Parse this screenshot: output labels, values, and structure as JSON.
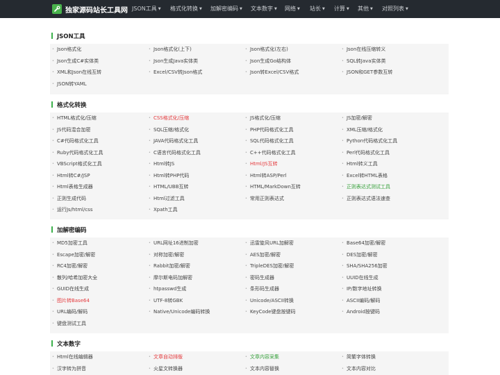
{
  "nav": {
    "brand": "独家源码站长工具网",
    "menu": [
      "JSON工具",
      "格式化转换",
      "加解密编码",
      "文本数字",
      "网络",
      "站长",
      "计算",
      "其他",
      "对照列表"
    ]
  },
  "sections": [
    {
      "title": "JSON工具",
      "items": [
        {
          "label": "Json格式化",
          "style": "normal"
        },
        {
          "label": "Json格式化(上下)",
          "style": "normal"
        },
        {
          "label": "Json格式化(左右)",
          "style": "normal"
        },
        {
          "label": "Json在线压缩转义",
          "style": "normal"
        },
        {
          "label": "Json生成C#实体类",
          "style": "normal"
        },
        {
          "label": "Json生成Java实体类",
          "style": "normal"
        },
        {
          "label": "Json生成Go结构体",
          "style": "normal"
        },
        {
          "label": "SQL转Java实体类",
          "style": "normal"
        },
        {
          "label": "XML和Json在线互转",
          "style": "normal"
        },
        {
          "label": "Excel/CSV转Json格式",
          "style": "normal"
        },
        {
          "label": "Json转Excel/CSV格式",
          "style": "normal"
        },
        {
          "label": "JSON和GET参数互转",
          "style": "normal"
        },
        {
          "label": "JSON转YAML",
          "style": "normal"
        }
      ]
    },
    {
      "title": "格式化转换",
      "items": [
        {
          "label": "HTML格式化/压缩",
          "style": "normal"
        },
        {
          "label": "CSS格式化/压缩",
          "style": "red"
        },
        {
          "label": "JS格式化/压缩",
          "style": "normal"
        },
        {
          "label": "JS加密/解密",
          "style": "normal"
        },
        {
          "label": "JS代码混合加密",
          "style": "normal"
        },
        {
          "label": "SQL压缩/格式化",
          "style": "normal"
        },
        {
          "label": "PHP代码格式化工具",
          "style": "normal"
        },
        {
          "label": "XML压缩/格式化",
          "style": "normal"
        },
        {
          "label": "C#代码格式化工具",
          "style": "normal"
        },
        {
          "label": "JAVA代码格式化工具",
          "style": "normal"
        },
        {
          "label": "SQL代码格式化工具",
          "style": "normal"
        },
        {
          "label": "Python代码格式化工具",
          "style": "normal"
        },
        {
          "label": "Ruby代码格式化工具",
          "style": "normal"
        },
        {
          "label": "C语言代码格式化工具",
          "style": "normal"
        },
        {
          "label": "C++代码格式化工具",
          "style": "normal"
        },
        {
          "label": "Perl代码格式化工具",
          "style": "normal"
        },
        {
          "label": "VBScript格式化工具",
          "style": "normal"
        },
        {
          "label": "Html转JS",
          "style": "normal"
        },
        {
          "label": "Html/JS互转",
          "style": "red"
        },
        {
          "label": "Html转义工具",
          "style": "normal"
        },
        {
          "label": "Html转C#/JSP",
          "style": "normal"
        },
        {
          "label": "Html转PHP代码",
          "style": "normal"
        },
        {
          "label": "Html转ASP/Perl",
          "style": "normal"
        },
        {
          "label": "Excel转HTML表格",
          "style": "normal"
        },
        {
          "label": "Html表格生成器",
          "style": "normal"
        },
        {
          "label": "HTML/UBB互转",
          "style": "normal"
        },
        {
          "label": "HTML/MarkDown互转",
          "style": "normal"
        },
        {
          "label": "正则表达式测试工具",
          "style": "green"
        },
        {
          "label": "正则生成代码",
          "style": "normal"
        },
        {
          "label": "Html过滤工具",
          "style": "normal"
        },
        {
          "label": "常用正则表达式",
          "style": "normal"
        },
        {
          "label": "正则表达式语法速查",
          "style": "normal"
        },
        {
          "label": "运行Js/html/css",
          "style": "normal"
        },
        {
          "label": "Xpath工具",
          "style": "normal"
        }
      ]
    },
    {
      "title": "加解密编码",
      "items": [
        {
          "label": "MD5加密工具",
          "style": "normal"
        },
        {
          "label": "URL网址16进制加密",
          "style": "normal"
        },
        {
          "label": "迅雷旋风URL加解密",
          "style": "normal"
        },
        {
          "label": "Base64加密/解密",
          "style": "normal"
        },
        {
          "label": "Escape加密/解密",
          "style": "normal"
        },
        {
          "label": "对称加密/解密",
          "style": "normal"
        },
        {
          "label": "AES加密/解密",
          "style": "normal"
        },
        {
          "label": "DES加密/解密",
          "style": "normal"
        },
        {
          "label": "RC4加密/解密",
          "style": "normal"
        },
        {
          "label": "Rabbit加密/解密",
          "style": "normal"
        },
        {
          "label": "TripleDES加密/解密",
          "style": "normal"
        },
        {
          "label": "SHA/SHA256加密",
          "style": "normal"
        },
        {
          "label": "散列/哈希加密大全",
          "style": "normal"
        },
        {
          "label": "摩尔斯电码加解密",
          "style": "normal"
        },
        {
          "label": "密码生成器",
          "style": "normal"
        },
        {
          "label": "UUID在线生成",
          "style": "normal"
        },
        {
          "label": "GUID在线生成",
          "style": "normal"
        },
        {
          "label": "htpasswd生成",
          "style": "normal"
        },
        {
          "label": "条形码生成器",
          "style": "normal"
        },
        {
          "label": "IP/数字地址转换",
          "style": "normal"
        },
        {
          "label": "图片转Base64",
          "style": "red"
        },
        {
          "label": "UTF-8转GBK",
          "style": "normal"
        },
        {
          "label": "Unicode/ASCII转换",
          "style": "normal"
        },
        {
          "label": "ASCII编码/解码",
          "style": "normal"
        },
        {
          "label": "URL编码/解码",
          "style": "normal"
        },
        {
          "label": "Native/Unicode编码转换",
          "style": "normal"
        },
        {
          "label": "KeyCode键盘按键码",
          "style": "normal"
        },
        {
          "label": "Android按键码",
          "style": "normal"
        },
        {
          "label": "键盘测试工具",
          "style": "normal"
        }
      ]
    },
    {
      "title": "文本数字",
      "items": [
        {
          "label": "Html在线编辑器",
          "style": "normal"
        },
        {
          "label": "文章自动排版",
          "style": "red"
        },
        {
          "label": "文章内容采集",
          "style": "green"
        },
        {
          "label": "简繁字体转换",
          "style": "normal"
        },
        {
          "label": "汉字转为拼音",
          "style": "normal"
        },
        {
          "label": "火星文转换器",
          "style": "normal"
        },
        {
          "label": "文本内容替换",
          "style": "normal"
        },
        {
          "label": "文本内容对比",
          "style": "normal"
        }
      ]
    }
  ]
}
